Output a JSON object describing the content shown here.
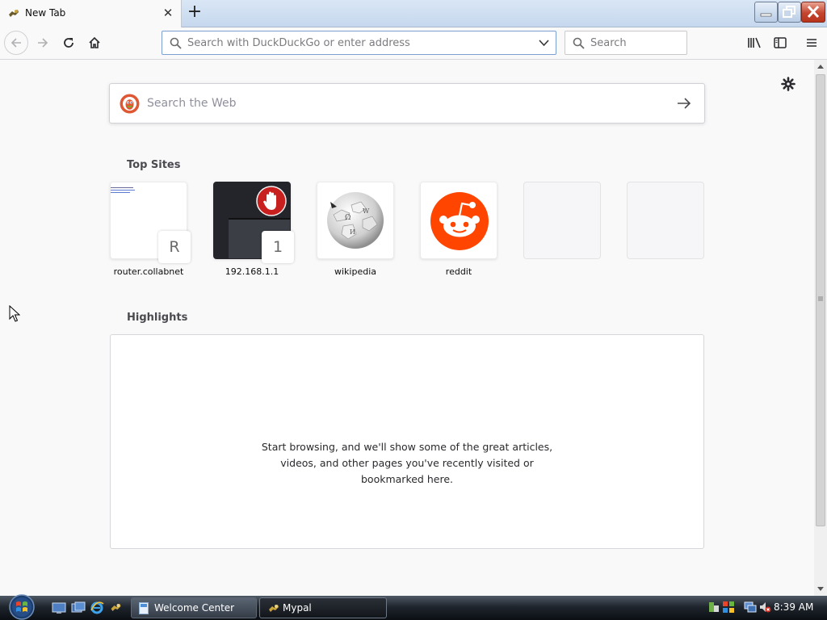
{
  "browser": {
    "tab": {
      "title": "New Tab",
      "close_label": "✕",
      "new_tab_label": "+"
    },
    "urlbar": {
      "placeholder": "Search with DuckDuckGo or enter address"
    },
    "searchbar": {
      "placeholder": "Search"
    }
  },
  "newtab": {
    "web_search": {
      "placeholder": "Search the Web"
    },
    "top_sites": {
      "title": "Top Sites",
      "tiles": [
        {
          "label": "router.collabnet",
          "badge": "R"
        },
        {
          "label": "192.168.1.1",
          "badge": "1"
        },
        {
          "label": "wikipedia"
        },
        {
          "label": "reddit"
        },
        {
          "label": ""
        },
        {
          "label": ""
        }
      ]
    },
    "highlights": {
      "title": "Highlights",
      "message_line1": "Start browsing, and we'll show some of the great articles,",
      "message_line2": "videos, and other pages you've recently visited or",
      "message_line3": "bookmarked here."
    }
  },
  "taskbar": {
    "items": [
      {
        "label": "Welcome Center"
      },
      {
        "label": "Mypal"
      }
    ],
    "clock": "8:39 AM"
  },
  "colors": {
    "reddit": "#ff4500",
    "duckduckgo": "#de5833",
    "accent_blue": "#7a9fd0"
  }
}
